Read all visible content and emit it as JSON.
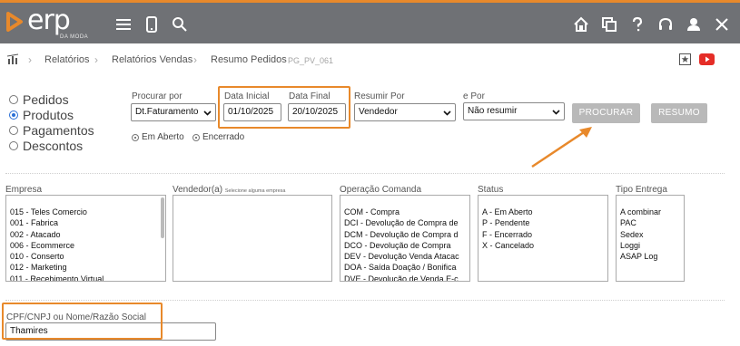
{
  "brand": {
    "name": "erp",
    "sub": "DA MODA",
    "accent": "#e8892b",
    "topbar_color": "#6f7175"
  },
  "topbar": {
    "left_icons": [
      "menu-icon",
      "mobile-icon",
      "search-icon"
    ],
    "right_icons": [
      "home-icon",
      "windows-icon",
      "help-icon",
      "headset-icon",
      "user-icon",
      "close-icon"
    ]
  },
  "breadcrumb": {
    "items": [
      "Relatórios",
      "Relatórios Vendas",
      "Resumo Pedidos"
    ],
    "code": "PG_PV_061",
    "right_icons": [
      "favorite-icon",
      "youtube-icon"
    ]
  },
  "report_type": {
    "options": [
      "Pedidos",
      "Produtos",
      "Pagamentos",
      "Descontos"
    ],
    "selected": "Produtos"
  },
  "filters": {
    "procurar_por": {
      "label": "Procurar por",
      "value": "Dt.Faturamento"
    },
    "data_inicial": {
      "label": "Data Inicial",
      "value": "01/10/2025"
    },
    "data_final": {
      "label": "Data Final",
      "value": "20/10/2025"
    },
    "resumir_por": {
      "label": "Resumir Por",
      "value": "Vendedor"
    },
    "e_por": {
      "label": "e Por",
      "value": "Não resumir"
    },
    "status_options": [
      "Em Aberto",
      "Encerrado"
    ]
  },
  "buttons": {
    "procurar": "PROCURAR",
    "resumo": "RESUMO"
  },
  "lists": {
    "empresa": {
      "title": "Empresa",
      "items": [
        "015 - Teles Comercio",
        "001 - Fabrica",
        "002 - Atacado",
        "006 - Ecommerce",
        "010 - Conserto",
        "012 - Marketing",
        "011 - Recebimento Virtual"
      ]
    },
    "vendedor": {
      "title": "Vendedor(a)",
      "hint": "Selecione alguma empresa",
      "items": []
    },
    "operacao": {
      "title": "Operação Comanda",
      "items": [
        "COM - Compra",
        "DCI - Devolução de Compra de",
        "DCM - Devolução de Compra d",
        "DCO - Devolução de Compra",
        "DEV - Devolução Venda Atacac",
        "DOA - Saída Doação / Bonifica",
        "DVE - Devolução de Venda E-c"
      ]
    },
    "status": {
      "title": "Status",
      "items": [
        "A - Em Aberto",
        "P - Pendente",
        "F - Encerrado",
        "X - Cancelado"
      ]
    },
    "tipo_entrega": {
      "title": "Tipo Entrega",
      "items": [
        "A combinar",
        "PAC",
        "Sedex",
        "Loggi",
        "ASAP Log"
      ]
    }
  },
  "cpf": {
    "label": "CPF/CNPJ ou Nome/Razão Social",
    "value": "Thamires"
  }
}
